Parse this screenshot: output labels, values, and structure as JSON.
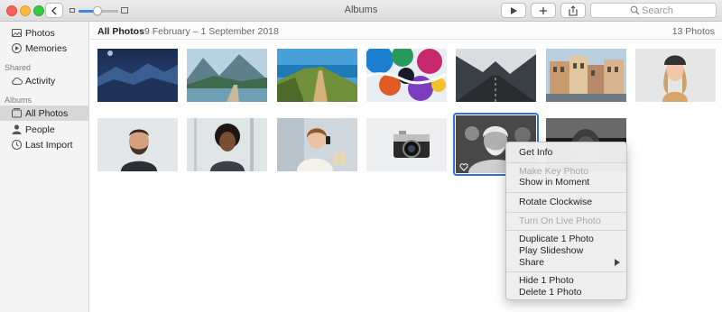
{
  "window": {
    "title": "Albums"
  },
  "toolbar": {
    "search_placeholder": "Search"
  },
  "sidebar": {
    "items_top": [
      {
        "label": "Photos",
        "icon": "photos-library-icon"
      },
      {
        "label": "Memories",
        "icon": "memories-icon"
      }
    ],
    "section_shared": "Shared",
    "items_shared": [
      {
        "label": "Activity",
        "icon": "cloud-icon"
      }
    ],
    "section_albums": "Albums",
    "items_albums": [
      {
        "label": "All Photos",
        "icon": "photos-stack-icon",
        "selected": true
      },
      {
        "label": "People",
        "icon": "person-icon"
      },
      {
        "label": "Last Import",
        "icon": "clock-icon"
      }
    ]
  },
  "main": {
    "title": "All Photos",
    "date_range": "9 February – 1 September 2018",
    "count": "13 Photos"
  },
  "photos": [
    {
      "name": "mountains-night-sky-photo",
      "selected": false
    },
    {
      "name": "mountain-lake-road-photo",
      "selected": false
    },
    {
      "name": "cliff-path-sea-photo",
      "selected": false
    },
    {
      "name": "colorful-abstract-paint-photo",
      "selected": false
    },
    {
      "name": "road-into-mountains-photo",
      "selected": false
    },
    {
      "name": "european-old-town-photo",
      "selected": false
    },
    {
      "name": "woman-in-beanie-photo",
      "selected": false
    },
    {
      "name": "bearded-man-portrait-photo",
      "selected": false
    },
    {
      "name": "woman-curly-hair-portrait-photo",
      "selected": false
    },
    {
      "name": "woman-smiling-phone-photo",
      "selected": false
    },
    {
      "name": "vintage-camera-photo",
      "selected": false
    },
    {
      "name": "elderly-man-black-white-photo",
      "selected": true
    },
    {
      "name": "man-black-white-portrait-photo",
      "selected": false
    }
  ],
  "context_menu": {
    "groups": [
      [
        {
          "label": "Get Info",
          "disabled": false
        }
      ],
      [
        {
          "label": "Make Key Photo",
          "disabled": true
        },
        {
          "label": "Show in Moment",
          "disabled": false
        }
      ],
      [
        {
          "label": "Rotate Clockwise",
          "disabled": false
        }
      ],
      [
        {
          "label": "Turn On Live Photo",
          "disabled": true
        }
      ],
      [
        {
          "label": "Duplicate 1 Photo",
          "disabled": false
        },
        {
          "label": "Play Slideshow",
          "disabled": false
        },
        {
          "label": "Share",
          "disabled": false,
          "submenu": true
        }
      ],
      [
        {
          "label": "Hide 1 Photo",
          "disabled": false
        },
        {
          "label": "Delete 1 Photo",
          "disabled": false
        }
      ]
    ]
  },
  "colors": {
    "selection_blue": "#2f6fe0",
    "sidebar_bg": "#f4f4f4",
    "sidebar_selected": "#d7d7d7"
  }
}
